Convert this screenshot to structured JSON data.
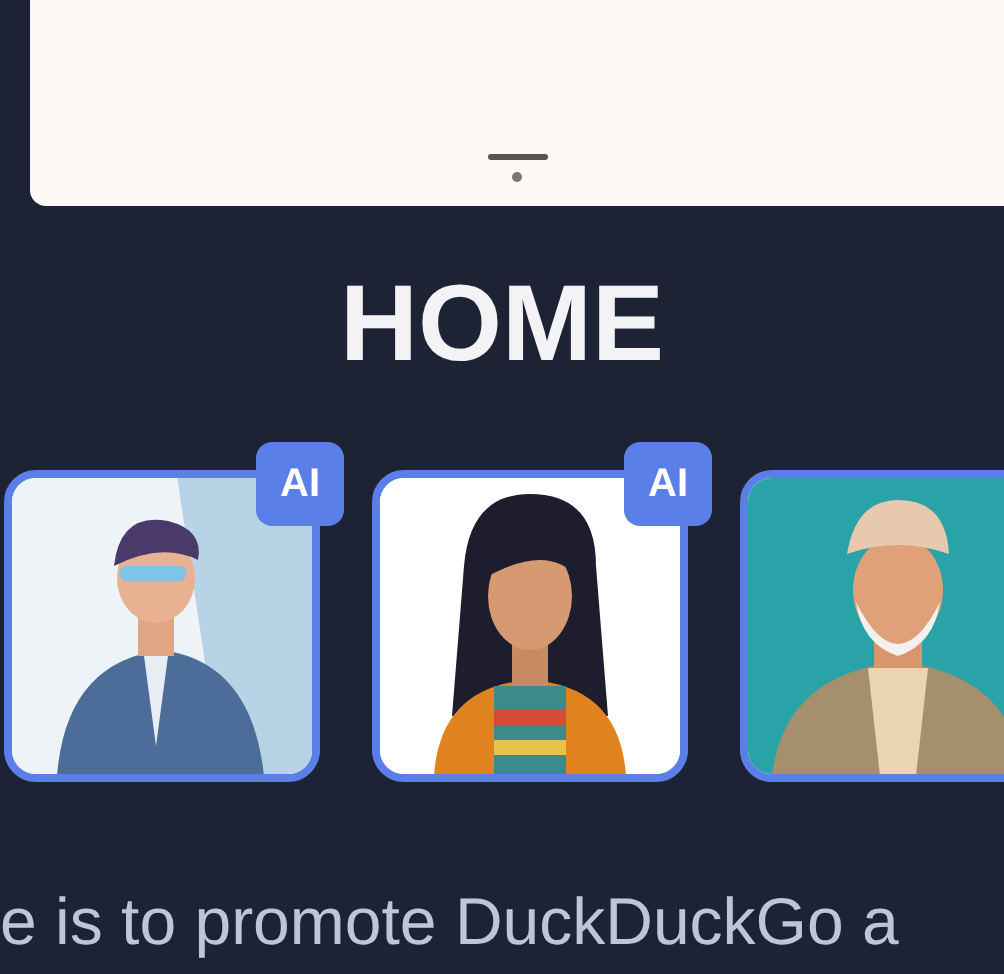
{
  "heading": "HOME",
  "cards": [
    {
      "kind": "suit",
      "badge": "AI"
    },
    {
      "kind": "girl",
      "badge": "AI"
    },
    {
      "kind": "elder"
    }
  ],
  "tagline": "e is to promote DuckDuckGo a"
}
